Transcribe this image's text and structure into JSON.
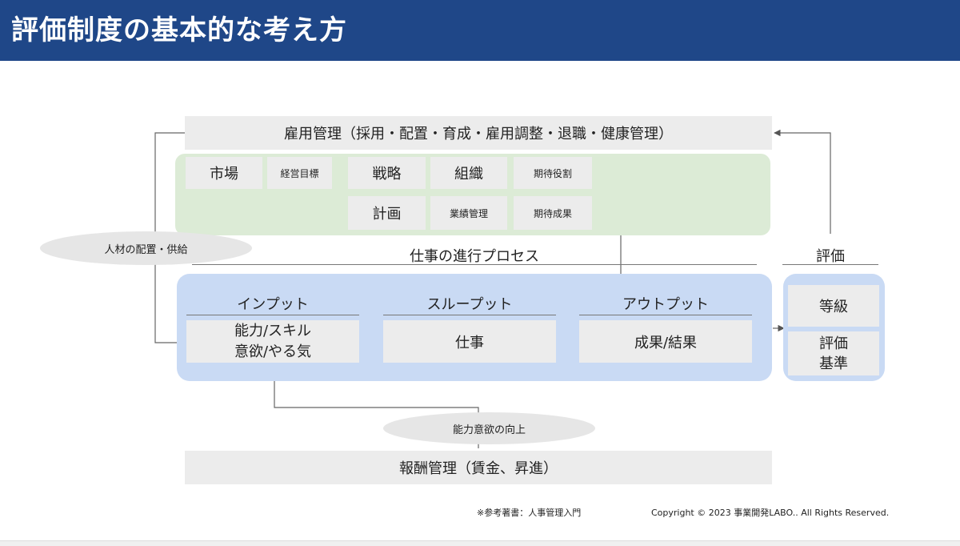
{
  "header": {
    "title": "評価制度の基本的な考え方"
  },
  "employment": "雇用管理（採用・配置・育成・雇用調整・退職・健康管理）",
  "strategy": {
    "market": "市場",
    "business_goal": "経営目標",
    "strategy": "戦略",
    "organization": "組織",
    "expected_role": "期待役割",
    "plan": "計画",
    "performance_mgmt": "業績管理",
    "expected_result": "期待成果"
  },
  "placement_label": "人材の配置・供給",
  "process": {
    "title": "仕事の進行プロセス",
    "input_title": "インプット",
    "input_line1": "能力/スキル",
    "input_line2": "意欲/やる気",
    "throughput_title": "スループット",
    "throughput_body": "仕事",
    "output_title": "アウトプット",
    "output_body": "成果/結果"
  },
  "evaluation": {
    "title": "評価",
    "grade": "等級",
    "criteria_line1": "評価",
    "criteria_line2": "基準"
  },
  "improvement_label": "能力意欲の向上",
  "compensation": "報酬管理（賃金、昇進）",
  "footer": {
    "reference": "※参考著書：人事管理入門",
    "copyright": "Copyright © 2023 事業開発LABO.. All Rights Reserved."
  }
}
